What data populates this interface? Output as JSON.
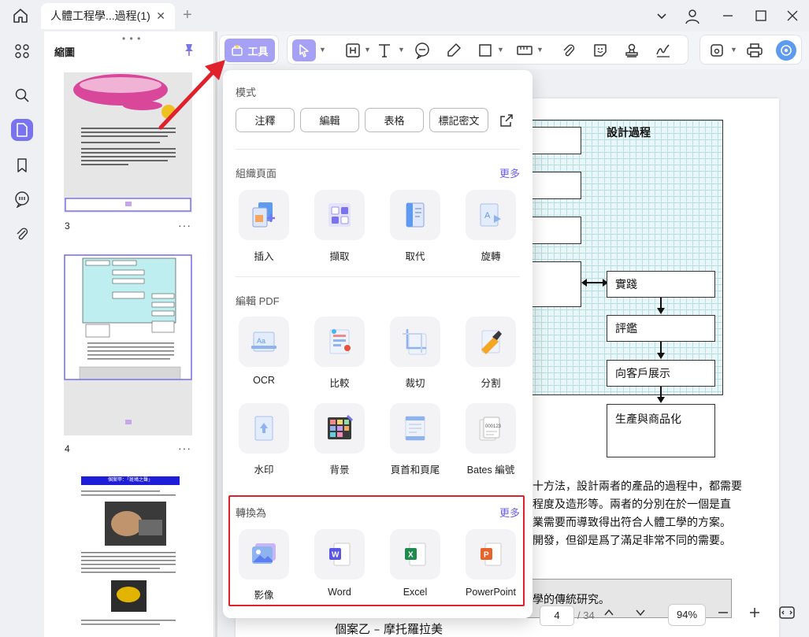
{
  "window": {
    "tab_title": "人體工程學...過程(1)",
    "tab_close": "✕",
    "new_tab": "+"
  },
  "thumbnails": {
    "title": "縮圖",
    "pages": [
      {
        "number": "3",
        "more": "···"
      },
      {
        "number": "4",
        "more": "···"
      }
    ],
    "mini_heading": "個案甲：「斑鳩之聲」"
  },
  "toolbar": {
    "tools_label": "工具"
  },
  "menu": {
    "mode_label": "模式",
    "modes": [
      "注釋",
      "編輯",
      "表格",
      "標記密文"
    ],
    "organize": {
      "label": "組織頁面",
      "more": "更多",
      "items": [
        "插入",
        "擷取",
        "取代",
        "旋轉"
      ]
    },
    "edit_pdf": {
      "label": "編輯 PDF",
      "items": [
        "OCR",
        "比較",
        "裁切",
        "分割",
        "水印",
        "背景",
        "頁首和頁尾",
        "Bates 編號"
      ]
    },
    "convert": {
      "label": "轉換為",
      "more": "更多",
      "items": [
        "影像",
        "Word",
        "Excel",
        "PowerPoint"
      ]
    }
  },
  "document": {
    "flow_title": "設計過程",
    "flow_boxes": [
      "實踐",
      "評鑑",
      "向客戶展示",
      "生產與商品化"
    ],
    "paragraph_lines": [
      "十方法，設計兩者的產品的過程中，都需要",
      "程度及造形等。兩者的分別在於一個是直",
      "業需要而導致得出符合人體工學的方案。",
      "開發，但卻是爲了滿足非常不同的需要。"
    ],
    "gray_text": "學的傳統研究。",
    "bottom_text": "個案乙 – 摩托羅拉美"
  },
  "nav": {
    "current_page": "4",
    "total": "/ 34",
    "zoom": "94%"
  },
  "colors": {
    "accent": "#7a73ef",
    "tools_button": "#a7a1f6",
    "highlight_red": "#e0202a",
    "grid_bg": "#e9f7f8"
  }
}
